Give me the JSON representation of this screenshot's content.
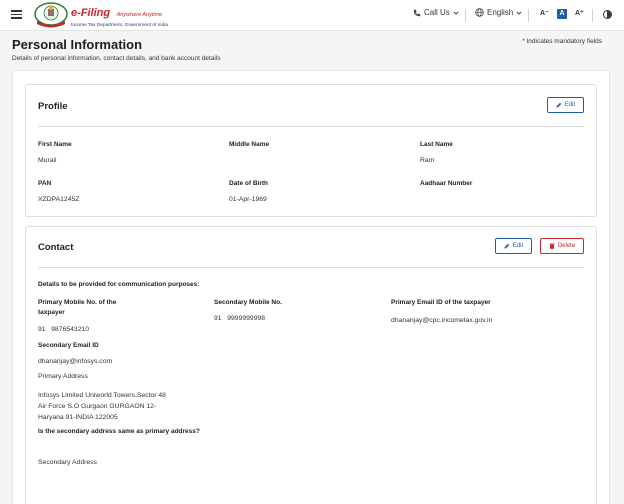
{
  "header": {
    "logo_lines": [
      "e-Filing",
      "Anywhere Anytime",
      "Income Tax Department, Government of India"
    ],
    "brand_title": "e-Filing",
    "brand_tagline": "Anywhere Anytime",
    "brand_subtitle": "Income Tax Department, Government of India",
    "call_us": "Call Us",
    "language": "English",
    "font_decrease": "A⁻",
    "font_default": "A",
    "font_increase": "A⁺"
  },
  "page": {
    "title": "Personal Information",
    "subtitle": "Details of personal information, contact details, and bank account details",
    "mandatory_note": "Indicates mandatory fields",
    "mandatory_star": "*"
  },
  "profile": {
    "title": "Profile",
    "edit_label": "Edit",
    "fields": {
      "first_name_label": "First Name",
      "first_name": "Murali",
      "middle_name_label": "Middle Name",
      "middle_name": "",
      "last_name_label": "Last Name",
      "last_name": "Ram",
      "pan_label": "PAN",
      "pan": "XZDPA1245Z",
      "dob_label": "Date of Birth",
      "dob": "01-Apr-1969",
      "aadhaar_label": "Aadhaar Number",
      "aadhaar": ""
    }
  },
  "contact": {
    "title": "Contact",
    "edit_label": "Edit",
    "delete_label": "Delete",
    "comm_heading": "Details to be provided for communication purposes:",
    "primary_mobile_label_1": "Primary Mobile No. of the",
    "primary_mobile_label_2": "taxpayer",
    "primary_mobile_code": "91",
    "primary_mobile": "9876543210",
    "secondary_mobile_label": "Secondary Mobile No.",
    "secondary_mobile_code": "91",
    "secondary_mobile": "9999999998",
    "primary_email_label": "Primary Email ID of the taxpayer",
    "primary_email": "dhananjay@cpc.incometax.gov.in",
    "secondary_email_label": "Secondary Email ID",
    "secondary_email": "dhananjay@infosys.com",
    "primary_address_label": "Primary Address",
    "address_line_1": "Infosys Limited  Uniworld Towers,Sector 48",
    "address_line_2": "Air Force S.O  Gurgaon  GURGAON  12-",
    "address_line_3": "Haryana  91-INDIA  122005",
    "same_address_question": "Is the secondary address same as primary address?",
    "secondary_address_label": "Secondary Address"
  },
  "colors": {
    "brand_red": "#c6262c",
    "accent_blue": "#1f5cab",
    "delete_red": "#c4272d"
  },
  "icons": [
    "menu-icon",
    "emblem-logo",
    "phone-icon",
    "globe-icon",
    "chevron-down-icon",
    "contrast-icon",
    "pencil-icon",
    "trash-icon"
  ]
}
